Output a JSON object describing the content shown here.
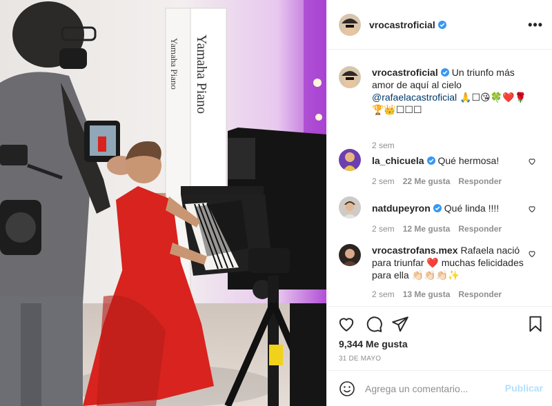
{
  "post": {
    "owner": "vrocastroficial",
    "more_icon": "more-horizontal-icon",
    "caption": {
      "username": "vrocastroficial",
      "text_a": "Un triunfo más amor de aquí al cielo",
      "mention": "@rafaelacastroficial",
      "text_b": "🙏☐😘🍀❤️🌹🏆👑☐☐☐",
      "time": "2 sem"
    },
    "photo_sign": {
      "line1": "Yamaha Piano",
      "line2": "Yamaha Piano"
    }
  },
  "comments": [
    {
      "username": "la_chicuela",
      "verified": true,
      "text": "Qué hermosa!",
      "time": "2 sem",
      "likes": "22 Me gusta",
      "reply": "Responder"
    },
    {
      "username": "natdupeyron",
      "verified": true,
      "text": "Qué linda !!!!",
      "time": "2 sem",
      "likes": "12 Me gusta",
      "reply": "Responder"
    },
    {
      "username": "vrocastrofans.mex",
      "verified": false,
      "text": "Rafaela nació para triunfar ❤️ muchas felicidades para ella 👏🏻👏🏻👏🏻✨",
      "time": "2 sem",
      "likes": "13 Me gusta",
      "reply": "Responder"
    }
  ],
  "actions": {
    "like_icon": "heart-icon",
    "comment_icon": "comment-icon",
    "share_icon": "share-icon",
    "save_icon": "bookmark-icon",
    "likes": "9,344 Me gusta",
    "date": "31 DE MAYO"
  },
  "add_comment": {
    "placeholder": "Agrega un comentario...",
    "publish": "Publicar",
    "emoji_icon": "emoji-icon"
  },
  "colors": {
    "verified": "#3897f0",
    "link": "#00376b",
    "publish_disabled": "#b2dffc",
    "dress": "#d8231f"
  }
}
